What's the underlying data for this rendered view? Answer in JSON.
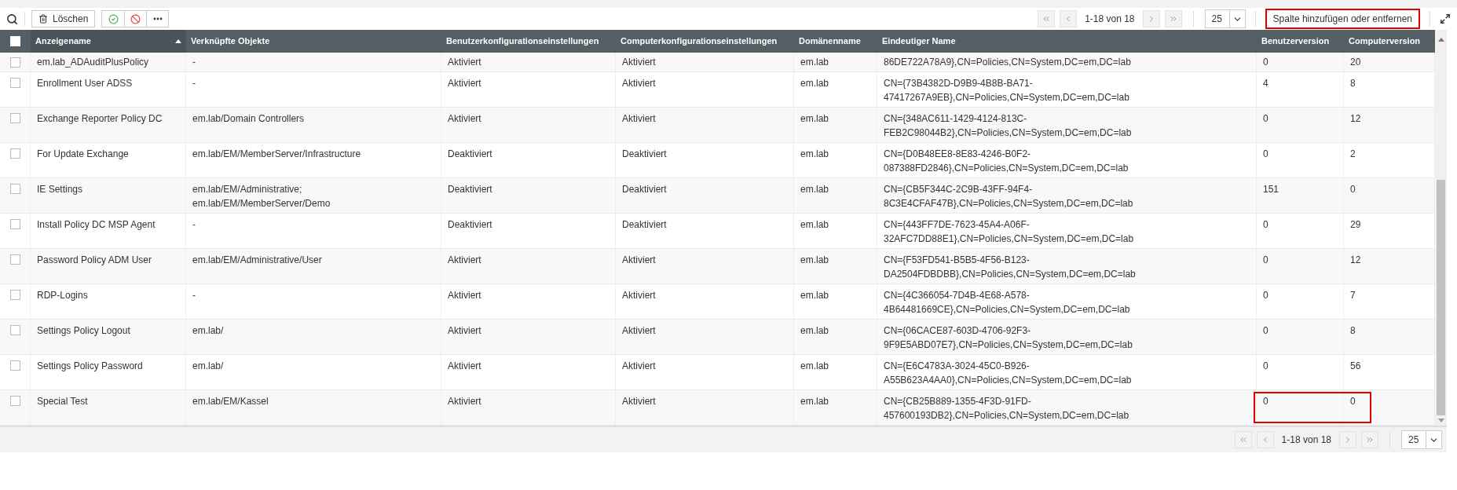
{
  "toolbar": {
    "delete_label": "Löschen"
  },
  "pager_top": {
    "range": "1-18 von 18",
    "page_size": "25"
  },
  "column_button": {
    "label": "Spalte hinzufügen oder entfernen",
    "highlighted": true
  },
  "table": {
    "select_all_checked": false,
    "columns": [
      {
        "label": "Anzeigename",
        "sorted": true
      },
      {
        "label": "Verknüpfte Objekte",
        "sorted": false
      },
      {
        "label": "Benutzerkonfigurationseinstellungen",
        "sorted": false
      },
      {
        "label": "Computerkonfigurationseinstellungen",
        "sorted": false
      },
      {
        "label": "Domänenname",
        "sorted": false
      },
      {
        "label": "Eindeutiger Name",
        "sorted": false
      },
      {
        "label": "Benutzerversion",
        "sorted": false
      },
      {
        "label": "Computerversion",
        "sorted": false
      }
    ],
    "rows": [
      {
        "cut_off": true,
        "checked": false,
        "name": "em.lab_ADAuditPlusPolicy",
        "linked": [
          "-"
        ],
        "user_config": "Aktiviert",
        "computer_config": "Aktiviert",
        "domain": "em.lab",
        "unique_name": "86DE722A78A9},CN=Policies,CN=System,DC=em,DC=lab",
        "user_version": "0",
        "computer_version": "20",
        "highlighted": false
      },
      {
        "cut_off": false,
        "checked": false,
        "name": "Enrollment User ADSS",
        "linked": [
          "-"
        ],
        "user_config": "Aktiviert",
        "computer_config": "Aktiviert",
        "domain": "em.lab",
        "unique_name": "CN={73B4382D-D9B9-4B8B-BA71-47417267A9EB},CN=Policies,CN=System,DC=em,DC=lab",
        "user_version": "4",
        "computer_version": "8",
        "highlighted": false
      },
      {
        "cut_off": false,
        "checked": false,
        "name": "Exchange Reporter Policy DC",
        "linked": [
          "em.lab/Domain Controllers"
        ],
        "user_config": "Aktiviert",
        "computer_config": "Aktiviert",
        "domain": "em.lab",
        "unique_name": "CN={348AC611-1429-4124-813C-FEB2C98044B2},CN=Policies,CN=System,DC=em,DC=lab",
        "user_version": "0",
        "computer_version": "12",
        "highlighted": false
      },
      {
        "cut_off": false,
        "checked": false,
        "name": "For Update Exchange",
        "linked": [
          "em.lab/EM/MemberServer/Infrastructure"
        ],
        "user_config": "Deaktiviert",
        "computer_config": "Deaktiviert",
        "domain": "em.lab",
        "unique_name": "CN={D0B48EE8-8E83-4246-B0F2-087388FD2846},CN=Policies,CN=System,DC=em,DC=lab",
        "user_version": "0",
        "computer_version": "2",
        "highlighted": false
      },
      {
        "cut_off": false,
        "checked": false,
        "name": "IE Settings",
        "linked": [
          "em.lab/EM/Administrative;",
          "em.lab/EM/MemberServer/Demo"
        ],
        "user_config": "Deaktiviert",
        "computer_config": "Deaktiviert",
        "domain": "em.lab",
        "unique_name": "CN={CB5F344C-2C9B-43FF-94F4-8C3E4CFAF47B},CN=Policies,CN=System,DC=em,DC=lab",
        "user_version": "151",
        "computer_version": "0",
        "highlighted": false
      },
      {
        "cut_off": false,
        "checked": false,
        "name": "Install Policy DC MSP Agent",
        "linked": [
          "-"
        ],
        "user_config": "Deaktiviert",
        "computer_config": "Deaktiviert",
        "domain": "em.lab",
        "unique_name": "CN={443FF7DE-7623-45A4-A06F-32AFC7DD88E1},CN=Policies,CN=System,DC=em,DC=lab",
        "user_version": "0",
        "computer_version": "29",
        "highlighted": false
      },
      {
        "cut_off": false,
        "checked": false,
        "name": "Password Policy ADM User",
        "linked": [
          "em.lab/EM/Administrative/User"
        ],
        "user_config": "Aktiviert",
        "computer_config": "Aktiviert",
        "domain": "em.lab",
        "unique_name": "CN={F53FD541-B5B5-4F56-B123-DA2504FDBDBB},CN=Policies,CN=System,DC=em,DC=lab",
        "user_version": "0",
        "computer_version": "12",
        "highlighted": false
      },
      {
        "cut_off": false,
        "checked": false,
        "name": "RDP-Logins",
        "linked": [
          "-"
        ],
        "user_config": "Aktiviert",
        "computer_config": "Aktiviert",
        "domain": "em.lab",
        "unique_name": "CN={4C366054-7D4B-4E68-A578-4B64481669CE},CN=Policies,CN=System,DC=em,DC=lab",
        "user_version": "0",
        "computer_version": "7",
        "highlighted": false
      },
      {
        "cut_off": false,
        "checked": false,
        "name": "Settings Policy Logout",
        "linked": [
          "em.lab/"
        ],
        "user_config": "Aktiviert",
        "computer_config": "Aktiviert",
        "domain": "em.lab",
        "unique_name": "CN={06CACE87-603D-4706-92F3-9F9E5ABD07E7},CN=Policies,CN=System,DC=em,DC=lab",
        "user_version": "0",
        "computer_version": "8",
        "highlighted": false
      },
      {
        "cut_off": false,
        "checked": false,
        "name": "Settings Policy Password",
        "linked": [
          "em.lab/"
        ],
        "user_config": "Aktiviert",
        "computer_config": "Aktiviert",
        "domain": "em.lab",
        "unique_name": "CN={E6C4783A-3024-45C0-B926-A55B623A4AA0},CN=Policies,CN=System,DC=em,DC=lab",
        "user_version": "0",
        "computer_version": "56",
        "highlighted": false
      },
      {
        "cut_off": false,
        "checked": false,
        "name": "Special Test",
        "linked": [
          "em.lab/EM/Kassel"
        ],
        "user_config": "Aktiviert",
        "computer_config": "Aktiviert",
        "domain": "em.lab",
        "unique_name": "CN={CB25B889-1355-4F3D-91FD-457600193DB2},CN=Policies,CN=System,DC=em,DC=lab",
        "user_version": "0",
        "computer_version": "0",
        "highlighted": true
      }
    ]
  },
  "pager_bottom": {
    "range": "1-18 von 18",
    "page_size": "25"
  }
}
